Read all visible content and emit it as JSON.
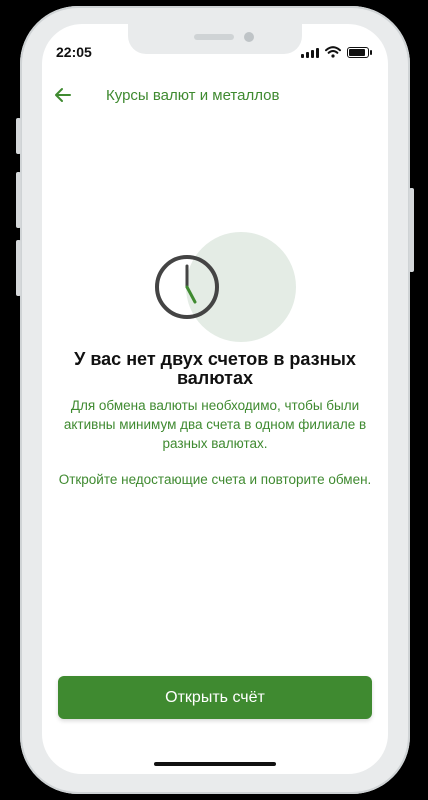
{
  "status_bar": {
    "time": "22:05"
  },
  "header": {
    "title": "Курсы валют и металлов",
    "back_icon": "arrow-left-icon"
  },
  "empty_state": {
    "icon": "clock-icon",
    "title": "У вас нет двух счетов в разных валютах",
    "message1": "Для обмена валюты необходимо, чтобы были активны минимум два счета в одном филиале в разных валютах.",
    "message2": "Откройте недостающие счета и повторите обмен."
  },
  "actions": {
    "open_account_label": "Открыть счёт"
  },
  "colors": {
    "accent": "#3f8a30",
    "illustration_bg": "#e4ece5"
  }
}
